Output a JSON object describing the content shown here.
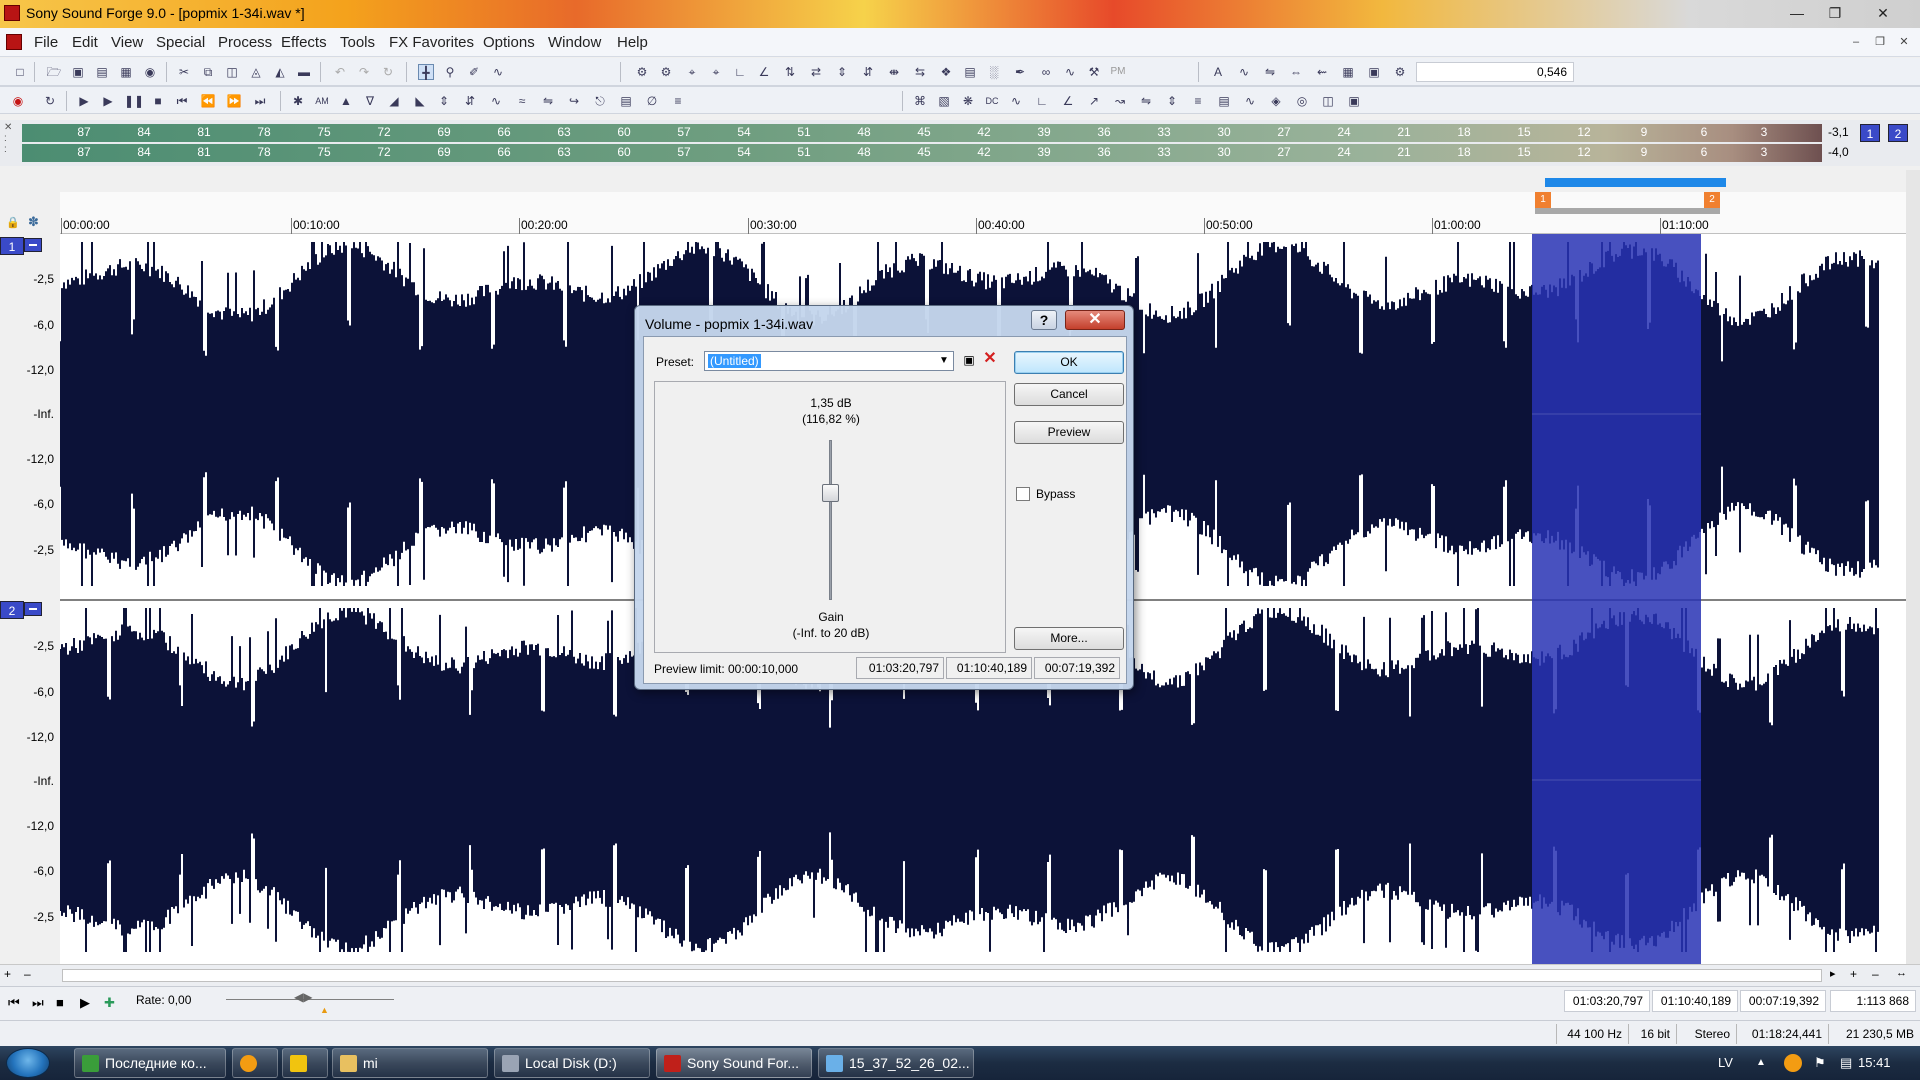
{
  "window": {
    "title": "Sony Sound Forge 9.0 - [popmix 1-34i.wav *]"
  },
  "menu": [
    "File",
    "Edit",
    "View",
    "Special",
    "Process",
    "Effects",
    "Tools",
    "FX Favorites",
    "Options",
    "Window",
    "Help"
  ],
  "toolbar": {
    "zoom_value": "0,546",
    "pm_label": "PM",
    "am_label": "AM",
    "dc_label": "DC"
  },
  "meters": {
    "scale": [
      "87",
      "84",
      "81",
      "78",
      "75",
      "72",
      "69",
      "66",
      "63",
      "60",
      "57",
      "54",
      "51",
      "48",
      "45",
      "42",
      "39",
      "36",
      "33",
      "30",
      "27",
      "24",
      "21",
      "18",
      "15",
      "12",
      "9",
      "6",
      "3"
    ],
    "peak_left": "-3,1",
    "peak_right": "-4,0",
    "channel_buttons": [
      "1",
      "2"
    ]
  },
  "ruler": {
    "ticks": [
      "00:00:00",
      "00:10:00",
      "00:20:00",
      "00:30:00",
      "00:40:00",
      "00:50:00",
      "01:00:00",
      "01:10:00"
    ],
    "markers": [
      "1",
      "2"
    ]
  },
  "tracks": [
    {
      "number": "1",
      "db_labels": [
        "-2,5",
        "-6,0",
        "-12,0",
        "-Inf.",
        "-12,0",
        "-6,0",
        "-2,5"
      ]
    },
    {
      "number": "2",
      "db_labels": [
        "-2,5",
        "-6,0",
        "-12,0",
        "-Inf.",
        "-12,0",
        "-6,0",
        "-2,5"
      ]
    }
  ],
  "dialog": {
    "title": "Volume - popmix 1-34i.wav",
    "preset_label": "Preset:",
    "preset_value": "(Untitled)",
    "gain_db": "1,35 dB",
    "gain_percent": "(116,82 %)",
    "gain_label": "Gain",
    "gain_range": "(-Inf. to 20 dB)",
    "gain_level_db": 1.35,
    "buttons": {
      "ok": "OK",
      "cancel": "Cancel",
      "preview": "Preview",
      "more": "More..."
    },
    "bypass_label": "Bypass",
    "bypass_checked": false,
    "preview_limit": "Preview limit: 00:00:10,000",
    "sel_start": "01:03:20,797",
    "sel_end": "01:10:40,189",
    "sel_length": "00:07:19,392",
    "help": "?",
    "close": "✕"
  },
  "transport": {
    "rate_label": "Rate: 0,00",
    "sel_start": "01:03:20,797",
    "sel_end": "01:10:40,189",
    "sel_length": "00:07:19,392",
    "zoom_ratio": "1:113 868"
  },
  "status": {
    "sample_rate": "44 100 Hz",
    "bit_depth": "16 bit",
    "channels": "Stereo",
    "duration": "01:18:24,441",
    "size": "21 230,5 MB"
  },
  "taskbar": {
    "items": [
      {
        "label": "Последние ко...",
        "color": "#3a9d3a"
      },
      {
        "label": "",
        "color": "#f39c12"
      },
      {
        "label": "",
        "color": "#f1c40f"
      },
      {
        "label": "mi",
        "color": "#e8c060"
      },
      {
        "label": "Local Disk (D:)",
        "color": "#9aa4b4"
      },
      {
        "label": "Sony Sound For...",
        "color": "#c0201a"
      },
      {
        "label": "15_37_52_26_02...",
        "color": "#6ab0e8"
      }
    ],
    "lang": "LV",
    "clock": "15:41"
  },
  "colors": {
    "waveform": "#0c1238",
    "selection": "#2a32b4",
    "accent": "#3a4ac8"
  }
}
